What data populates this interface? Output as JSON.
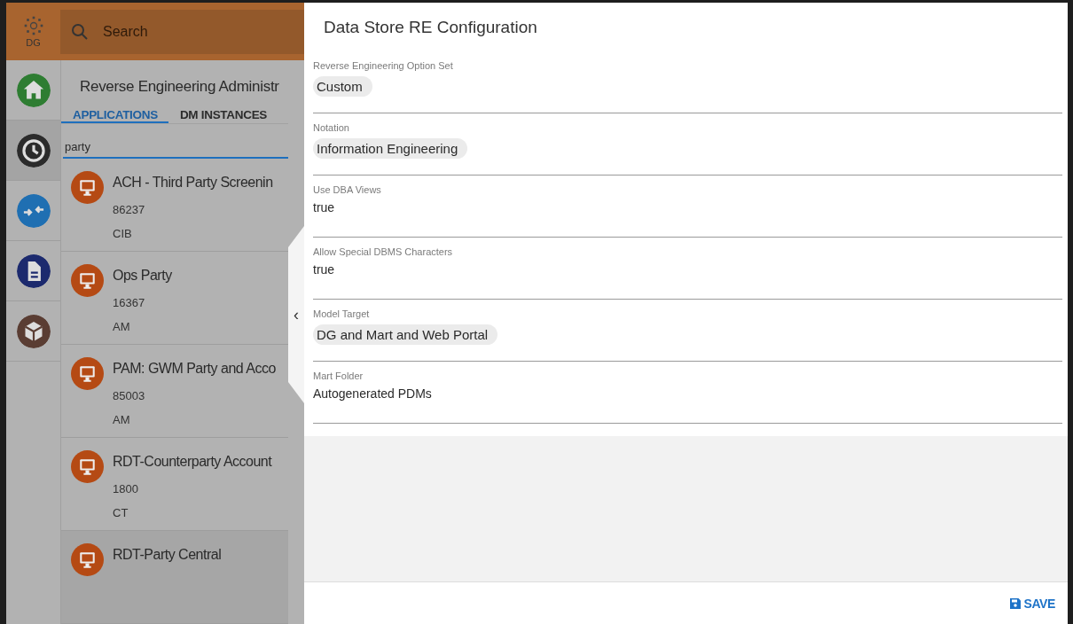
{
  "logo": {
    "text": "DG"
  },
  "search": {
    "placeholder": "Search"
  },
  "rail_items": [
    {
      "kind": "home",
      "color": "#2e7d32",
      "selected": false
    },
    {
      "kind": "clock",
      "color": "#2b2b2b",
      "selected": true
    },
    {
      "kind": "arrows",
      "color": "#1f6fb2",
      "selected": false
    },
    {
      "kind": "document",
      "color": "#1c2a6e",
      "selected": false
    },
    {
      "kind": "box",
      "color": "#5a3d33",
      "selected": false
    }
  ],
  "page_title": "Reverse Engineering Administr",
  "tabs": [
    {
      "label": "APPLICATIONS",
      "selected": true
    },
    {
      "label": "DM INSTANCES",
      "selected": false
    }
  ],
  "filter": {
    "value": "party"
  },
  "applications": [
    {
      "name": "ACH - Third Party Screenin",
      "id": "86237",
      "code": "CIB",
      "selected": false
    },
    {
      "name": "Ops Party",
      "id": "16367",
      "code": "AM",
      "selected": false
    },
    {
      "name": "PAM: GWM Party and Acco",
      "id": "85003",
      "code": "AM",
      "selected": false
    },
    {
      "name": "RDT-Counterparty Account",
      "id": "1800",
      "code": "CT",
      "selected": false
    },
    {
      "name": "RDT-Party Central",
      "selected": true
    }
  ],
  "collapse_handle": {
    "glyph": "‹"
  },
  "panel": {
    "title": "Data Store RE Configuration",
    "fields": [
      {
        "label": "Reverse Engineering Option Set",
        "value": "Custom",
        "kind": "chip"
      },
      {
        "label": "Notation",
        "value": "Information Engineering",
        "kind": "chip"
      },
      {
        "label": "Use DBA Views",
        "value": "true",
        "kind": "text"
      },
      {
        "label": "Allow Special DBMS Characters",
        "value": "true",
        "kind": "text"
      },
      {
        "label": "Model Target",
        "value": "DG and Mart and Web Portal",
        "kind": "chip"
      },
      {
        "label": "Mart Folder",
        "value": "Autogenerated PDMs",
        "kind": "text"
      }
    ],
    "save_label": "SAVE"
  }
}
